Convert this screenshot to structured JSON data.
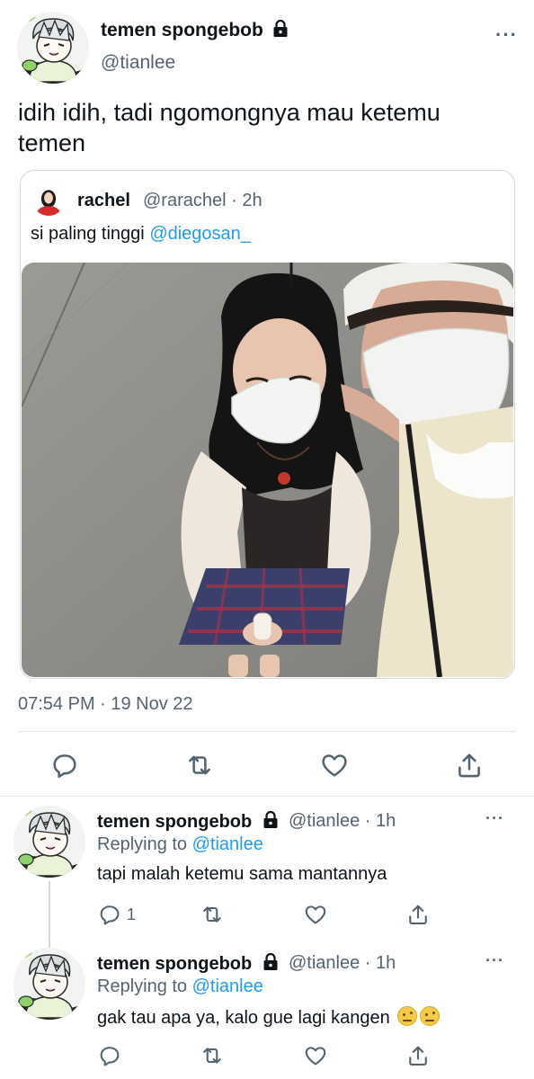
{
  "main_tweet": {
    "display_name": "temen spongebob",
    "handle": "@tianlee",
    "text": "idih idih, tadi ngomongnya mau ketemu temen",
    "timestamp": "07:54 PM · 19 Nov 22",
    "more": "···"
  },
  "quoted_tweet": {
    "display_name": "rachel",
    "handle": "@rarachel · 2h",
    "text_prefix": "si paling tinggi ",
    "mention": "@diegosan_"
  },
  "replies": [
    {
      "display_name": "temen spongebob",
      "handle": "@tianlee · 1h",
      "replying_prefix": "Replying to ",
      "replying_to": "@tianlee",
      "text": "tapi malah ketemu sama mantannya",
      "reply_count": "1",
      "more": "···"
    },
    {
      "display_name": "temen spongebob",
      "handle": "@tianlee · 1h",
      "replying_prefix": "Replying to ",
      "replying_to": "@tianlee",
      "text": "gak tau apa ya, kalo gue lagi kangen",
      "more": "···"
    }
  ],
  "icons": {
    "reply": "reply-icon",
    "retweet": "retweet-icon",
    "like": "like-icon",
    "share": "share-icon",
    "lock": "lock-icon"
  },
  "colors": {
    "link": "#1d9bf0",
    "secondary_text": "#536471",
    "primary_text": "#0f1419",
    "divider": "#e1e8ed"
  }
}
